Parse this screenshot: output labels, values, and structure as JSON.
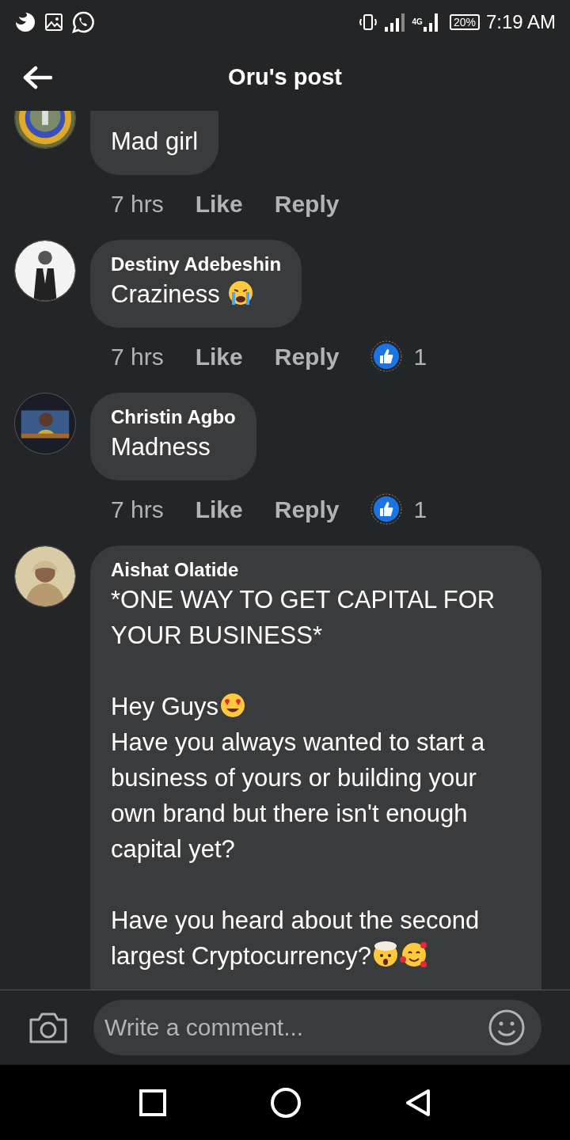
{
  "status_bar": {
    "battery": "20%",
    "time": "7:19 AM",
    "network": "4G"
  },
  "header": {
    "title": "Oru's post"
  },
  "comments": [
    {
      "body": [
        {
          "kind": "plain",
          "text": "Mad girl"
        }
      ],
      "time": "7 hrs",
      "like": "Like",
      "reply": "Reply"
    },
    {
      "author": "Destiny Adebeshin",
      "body": [
        {
          "kind": "crying",
          "text": "Craziness "
        }
      ],
      "time": "7 hrs",
      "like": "Like",
      "reply": "Reply",
      "reactions": "1"
    },
    {
      "author": "Christin Agbo",
      "body": [
        {
          "kind": "plain",
          "text": "Madness"
        }
      ],
      "time": "7 hrs",
      "like": "Like",
      "reply": "Reply",
      "reactions": "1"
    },
    {
      "author": "Aishat Olatide",
      "body": [
        {
          "kind": "plain",
          "text": "*ONE WAY TO GET CAPITAL FOR YOUR BUSINESS*"
        },
        {
          "kind": "heart-eyes",
          "text": "Hey Guys",
          "space_before": true
        },
        {
          "kind": "plain",
          "text": "Have you always wanted to start a business of yours or building your own brand but there isn't enough capital yet?"
        },
        {
          "kind": "plain",
          "text": "Have you heard about the second",
          "space_before": true
        },
        {
          "kind": "exploding-head-hearts",
          "text": "largest Cryptocurrency?"
        }
      ]
    }
  ],
  "composer": {
    "placeholder": "Write a comment..."
  }
}
